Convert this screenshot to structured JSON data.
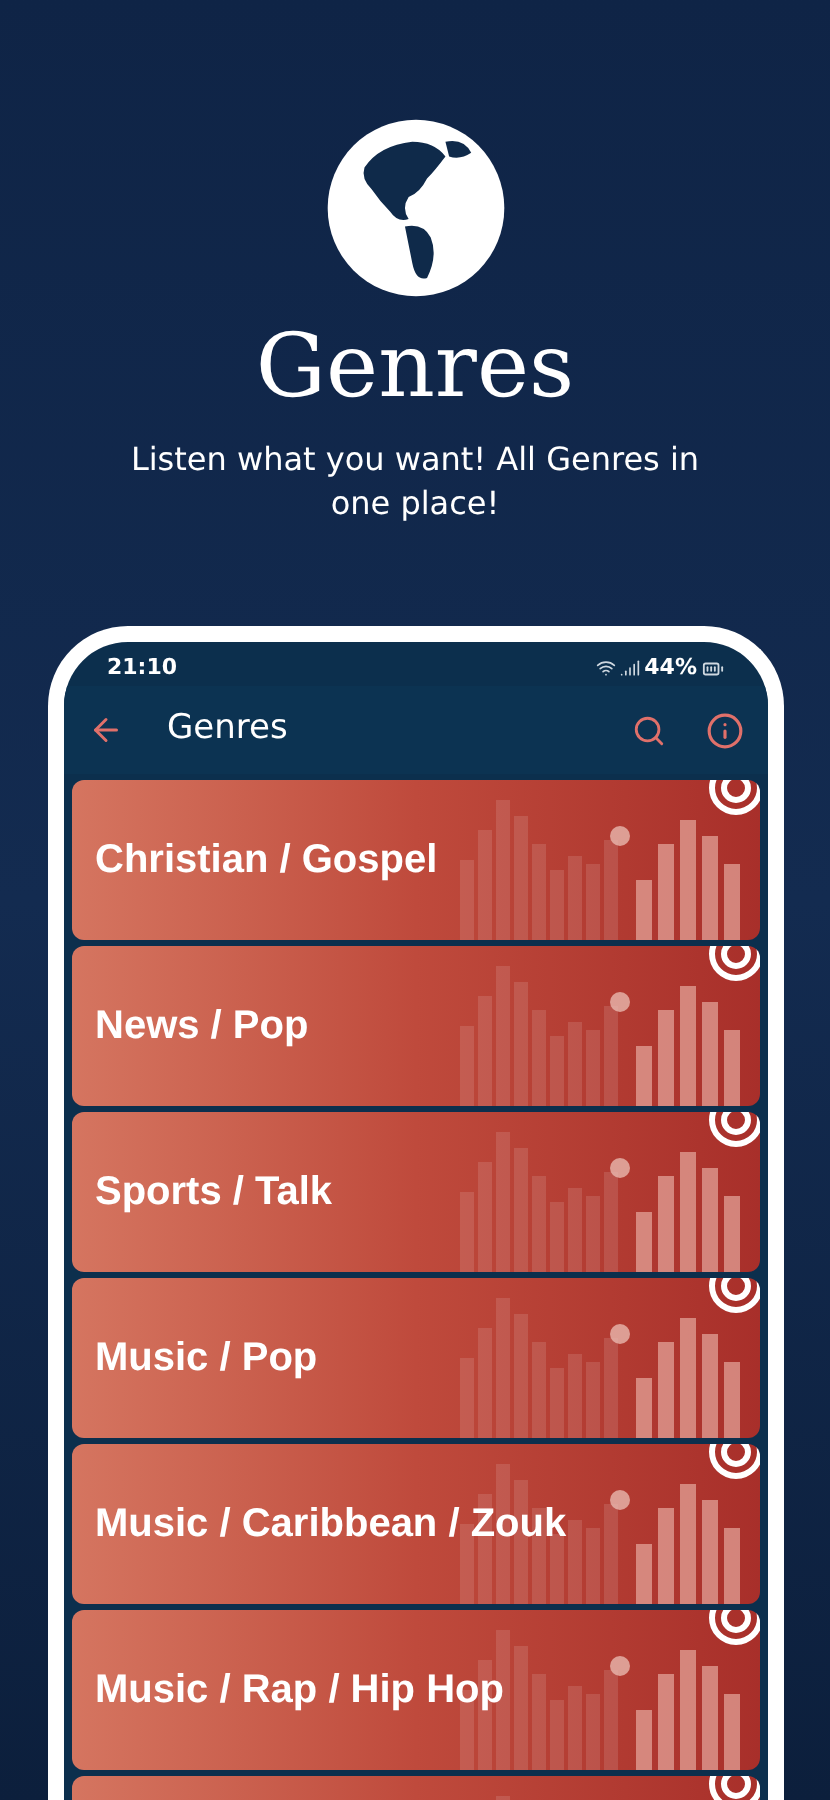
{
  "hero": {
    "title": "Genres",
    "subtitle": "Listen what you want! All Genres in one place!"
  },
  "status_bar": {
    "time": "21:10",
    "battery": "44%"
  },
  "app_bar": {
    "title": "Genres"
  },
  "genres": [
    {
      "title": "Christian / Gospel"
    },
    {
      "title": "News / Pop"
    },
    {
      "title": "Sports / Talk"
    },
    {
      "title": "Music / Pop"
    },
    {
      "title": "Music / Caribbean / Zouk"
    },
    {
      "title": "Music / Rap / Hip Hop"
    }
  ],
  "more_below": true
}
